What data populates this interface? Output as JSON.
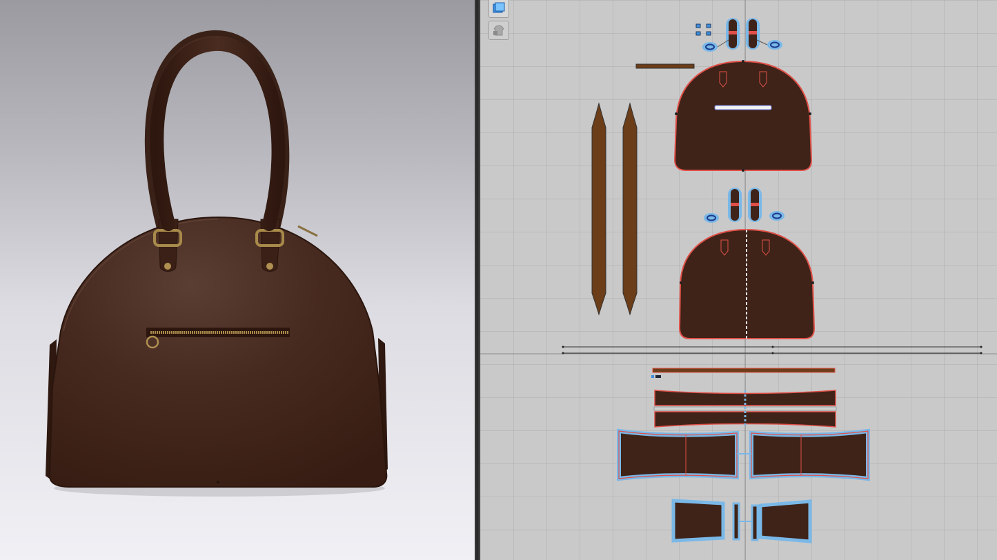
{
  "views": {
    "left": "3d-avatar-viewport",
    "right": "2d-pattern-window"
  },
  "colors": {
    "leather": "#3f2318",
    "leather_highlight": "#5a3a2e",
    "handle_strip": "#6b3d18",
    "zipper_brass": "#a88a4a",
    "seam_red": "#e05048",
    "selection_blue": "#7ab8e8",
    "grid_bg": "#c9c9c9"
  },
  "toolbar": {
    "tools": [
      {
        "icon": "sheet-pattern-icon",
        "active": true
      },
      {
        "icon": "locked-garment-icon",
        "active": false
      }
    ]
  },
  "model": {
    "object": "handbag",
    "features": [
      "double-handles",
      "front-zip-pocket",
      "brass-rings",
      "rivets"
    ]
  }
}
